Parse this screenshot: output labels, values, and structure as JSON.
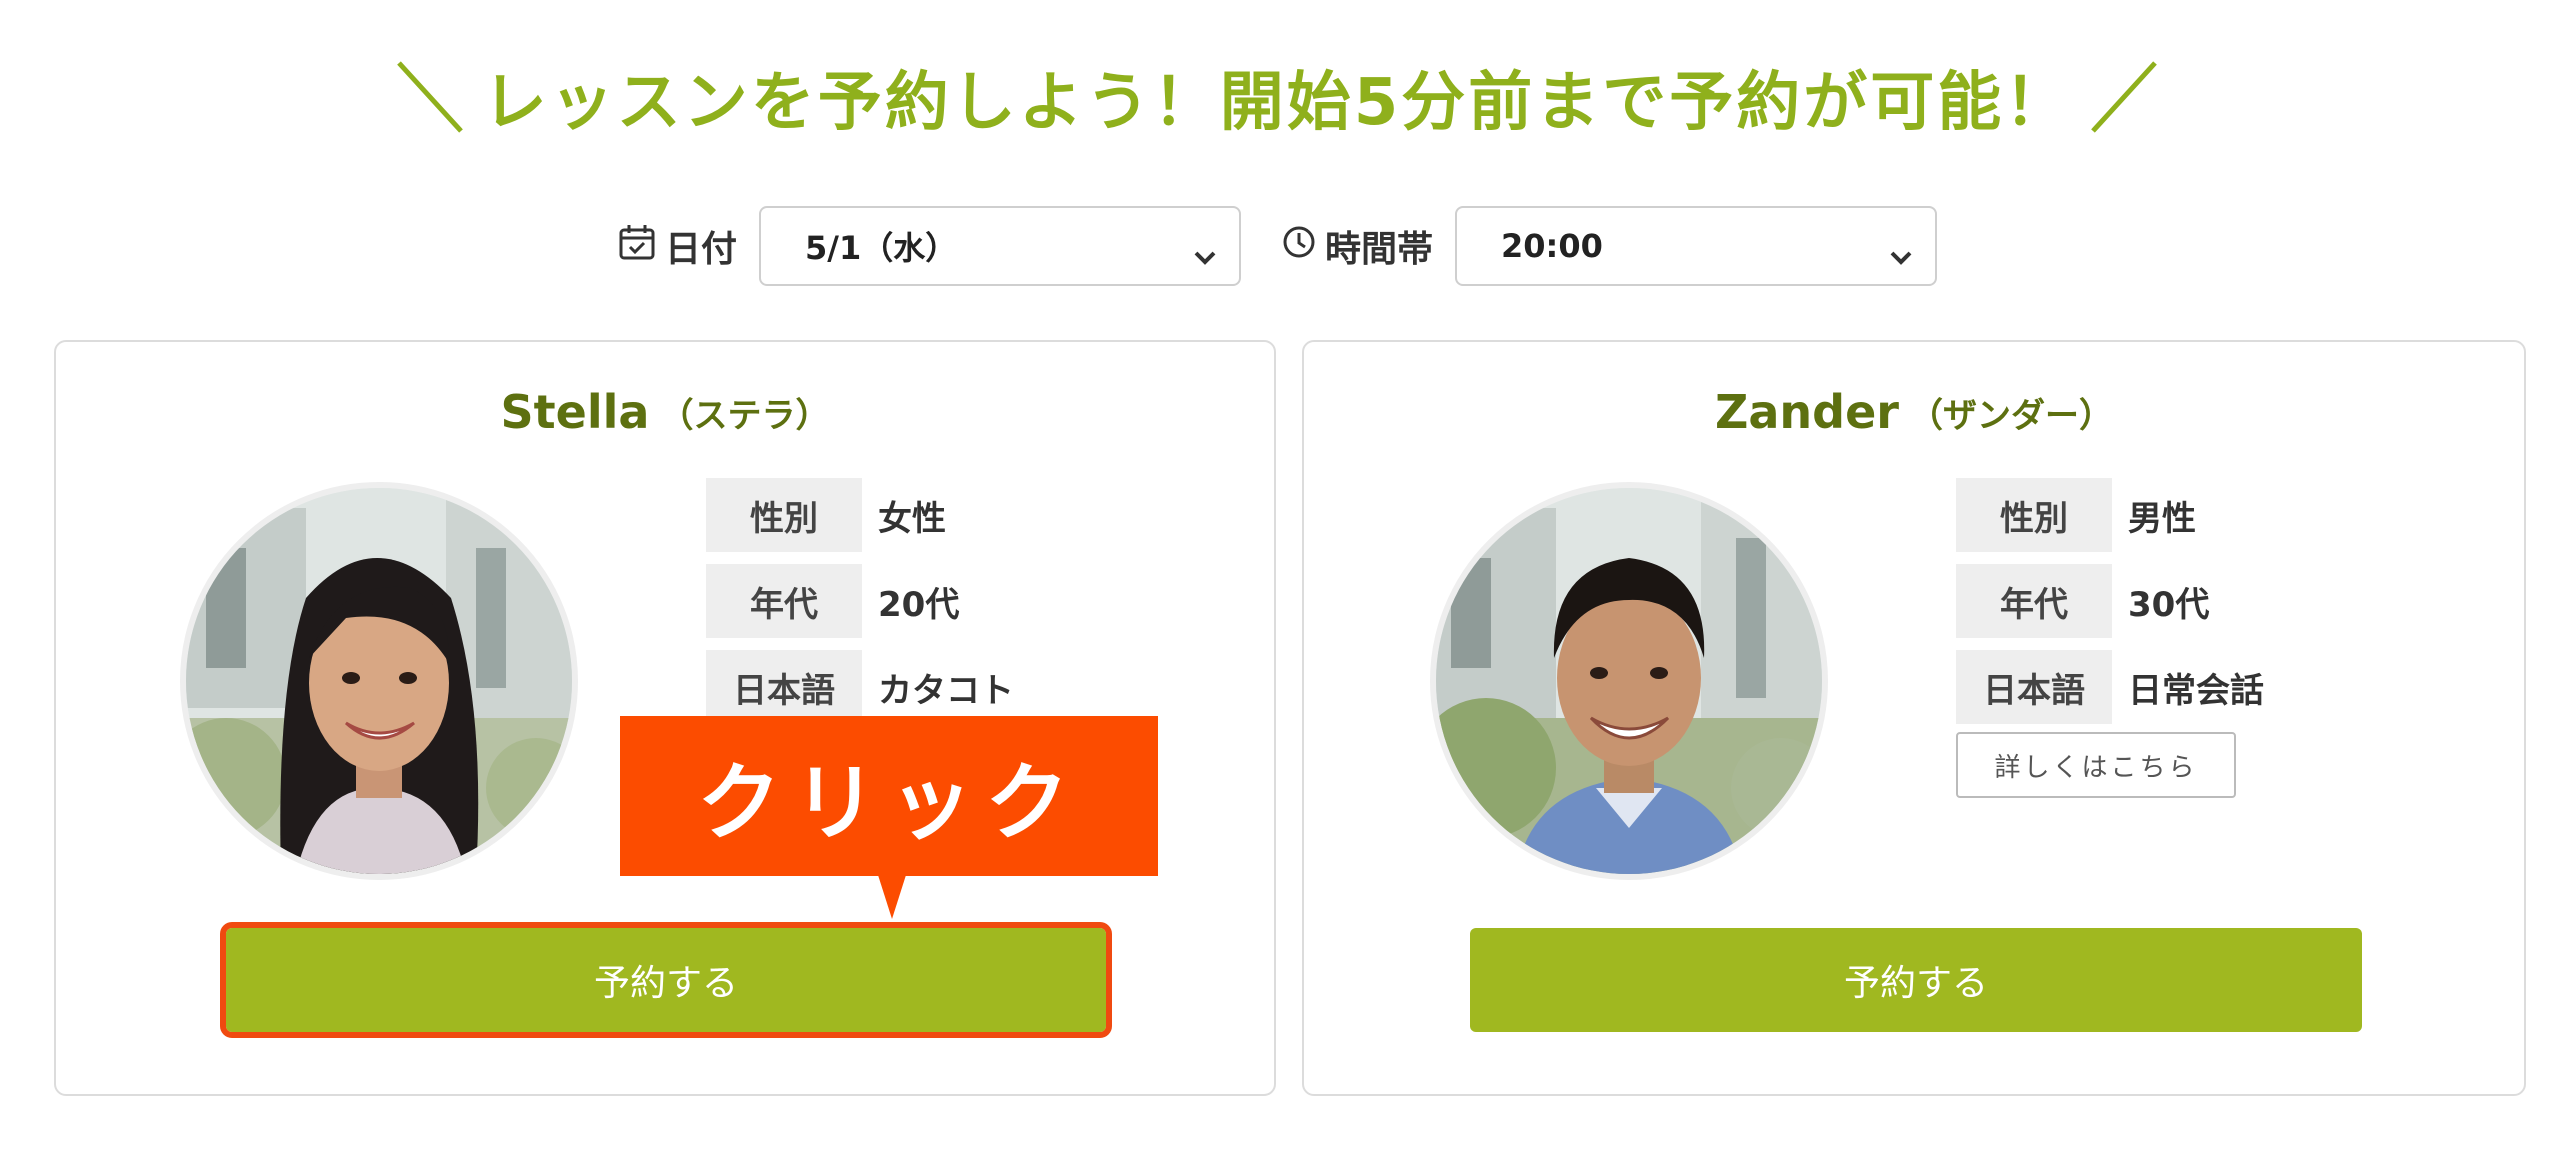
{
  "headline": {
    "text": "レッスンを予約しよう！開始5分前まで予約が可能！"
  },
  "filters": {
    "date_label": "日付",
    "date_value": "5/1（水）",
    "time_label": "時間帯",
    "time_value": "20:00"
  },
  "icons": {
    "calendar": "calendar-check-icon",
    "clock": "clock-icon",
    "chevron": "chevron-down-icon"
  },
  "colors": {
    "accent": "#8fb01c",
    "button": "#a0b820",
    "callout": "#fc4c00",
    "name": "#5d7010"
  },
  "teachers": [
    {
      "name": "Stella",
      "kana": "（ステラ）",
      "info": [
        {
          "key": "性別",
          "value": "女性"
        },
        {
          "key": "年代",
          "value": "20代"
        },
        {
          "key": "日本語",
          "value": "カタコト"
        }
      ],
      "reserve_label": "予約する"
    },
    {
      "name": "Zander",
      "kana": "（ザンダー）",
      "info": [
        {
          "key": "性別",
          "value": "男性"
        },
        {
          "key": "年代",
          "value": "30代"
        },
        {
          "key": "日本語",
          "value": "日常会話"
        }
      ],
      "details_label": "詳しくはこちら",
      "reserve_label": "予約する"
    }
  ],
  "callout": {
    "text": "クリック"
  }
}
